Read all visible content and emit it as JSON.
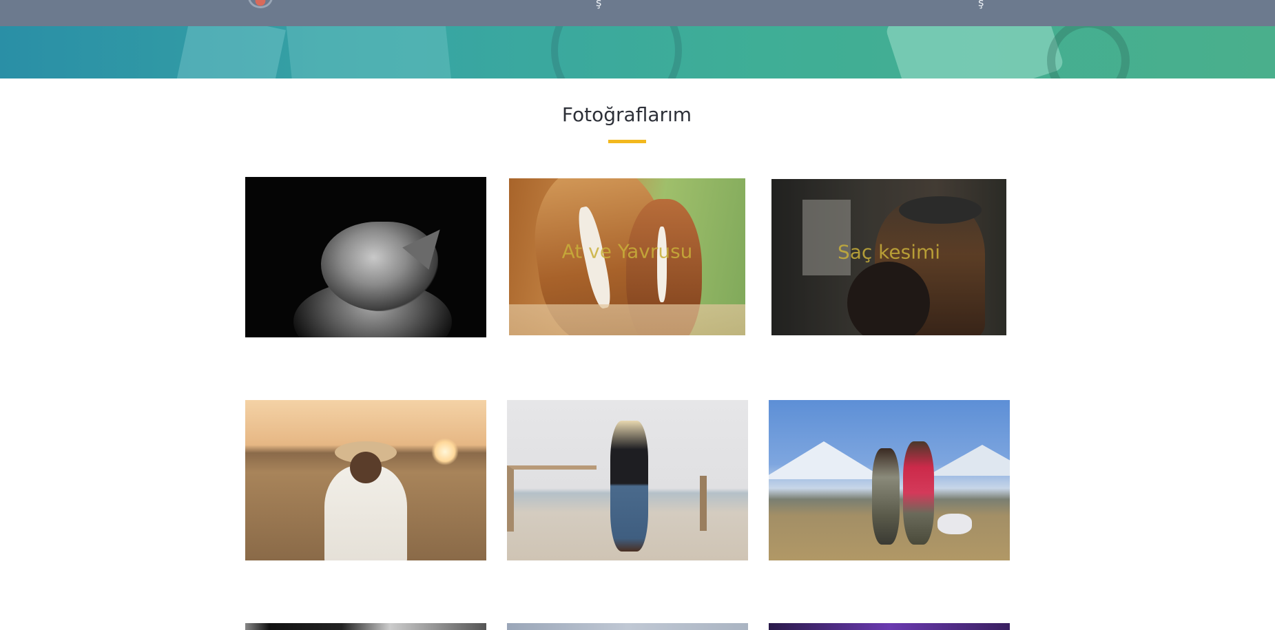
{
  "section": {
    "title": "Fotoğraflarım"
  },
  "nav": {
    "glyph_left": "ş",
    "glyph_right": "ş"
  },
  "gallery": {
    "row1": [
      {
        "caption": ""
      },
      {
        "caption": "At ve Yavrusu"
      },
      {
        "caption": "Saç kesimi"
      }
    ],
    "row2": [
      {
        "caption": ""
      },
      {
        "caption": ""
      },
      {
        "caption": ""
      }
    ]
  },
  "colors": {
    "navbar": "#6c7a8e",
    "accent_underline": "#f2b81e",
    "caption": "#c9b03a",
    "title": "#2d3038"
  }
}
